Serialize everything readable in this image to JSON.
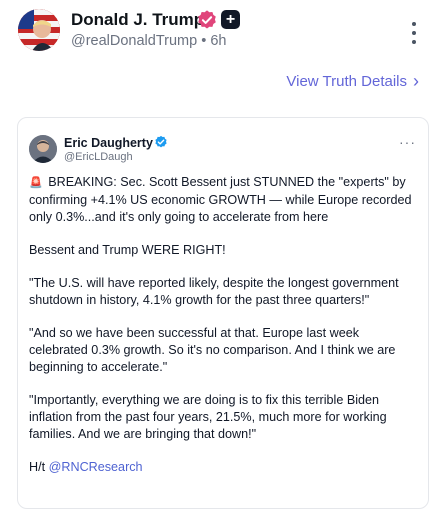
{
  "post": {
    "author_name": "Donald J. Trump",
    "handle": "@realDonaldTrump",
    "separator": "•",
    "time": "6h",
    "view_details": "View Truth Details",
    "chevron": "›"
  },
  "quote": {
    "author_name": "Eric Daugherty",
    "handle": "@EricLDaugh",
    "more": "···",
    "siren_icon": "🚨",
    "paragraphs": [
      "BREAKING: Sec. Scott Bessent just STUNNED the \"experts\" by confirming +4.1% US economic GROWTH — while Europe recorded only 0.3%...and it's only going to accelerate from here",
      "Bessent and Trump WERE RIGHT!",
      "\"The U.S. will have reported likely, despite the longest government shutdown in history, 4.1% growth for the past three quarters!\"",
      "\"And so we have been successful at that. Europe last week celebrated 0.3% growth. So it's no comparison. And I think we are beginning to accelerate.\"",
      "\"Importantly, everything we are doing is to fix this terrible Biden inflation from the past four years, 21.5%, much more for working families. And we are bringing that down!\""
    ],
    "hat_tip_prefix": "H/t ",
    "hat_tip_mention": "@RNCResearch"
  },
  "colors": {
    "link": "#6366d8",
    "verified_post": "#e0457b",
    "verified_quote": "#1d9bf0"
  }
}
